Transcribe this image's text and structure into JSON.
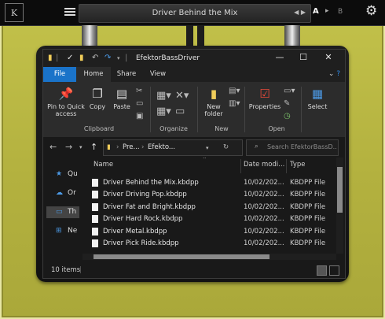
{
  "plugin": {
    "logo_text": "K",
    "preset_name": "Driver Behind the Mix",
    "preset_arrows": "◀ ▶",
    "ab_a": "A",
    "ab_arrow": "▸",
    "ab_b": "B"
  },
  "window": {
    "title": "EfektorBassDriver",
    "controls": {
      "minimize": "—",
      "maximize": "☐",
      "close": "✕"
    }
  },
  "ribbon_tabs": [
    "File",
    "Home",
    "Share",
    "View"
  ],
  "ribbon": {
    "pin_label": "Pin to Quick access",
    "copy_label": "Copy",
    "paste_label": "Paste",
    "new_folder_label": "New folder",
    "properties_label": "Properties",
    "select_label": "Select",
    "groups": {
      "clipboard": "Clipboard",
      "organize": "Organize",
      "new": "New",
      "open": "Open"
    }
  },
  "addressbar": {
    "crumb_1": "Pre...",
    "crumb_2": "Efekto...",
    "search_placeholder": "Search EfektorBassD..."
  },
  "navpane": {
    "items": [
      {
        "label": "Qu",
        "icon": "star-icon"
      },
      {
        "label": "Or",
        "icon": "cloud-icon"
      },
      {
        "label": "Th",
        "icon": "monitor-icon"
      },
      {
        "label": "Ne",
        "icon": "network-icon"
      }
    ]
  },
  "filelist": {
    "columns": {
      "name": "Name",
      "date": "Date modi...",
      "type": "Type"
    },
    "files": [
      {
        "name": "Driver Behind the Mix.kbdpp",
        "date": "10/02/202...",
        "type": "KBDPP File"
      },
      {
        "name": "Driver Driving Pop.kbdpp",
        "date": "10/02/202...",
        "type": "KBDPP File"
      },
      {
        "name": "Driver Fat and Bright.kbdpp",
        "date": "10/02/202...",
        "type": "KBDPP File"
      },
      {
        "name": "Driver Hard Rock.kbdpp",
        "date": "10/02/202...",
        "type": "KBDPP File"
      },
      {
        "name": "Driver Metal.kbdpp",
        "date": "10/02/202...",
        "type": "KBDPP File"
      },
      {
        "name": "Driver Pick Ride.kbdpp",
        "date": "10/02/202...",
        "type": "KBDPP File"
      }
    ]
  },
  "status": {
    "count": "10 items"
  },
  "colors": {
    "accent": "#1a73c9",
    "plugin_bg": "#b6b442"
  }
}
